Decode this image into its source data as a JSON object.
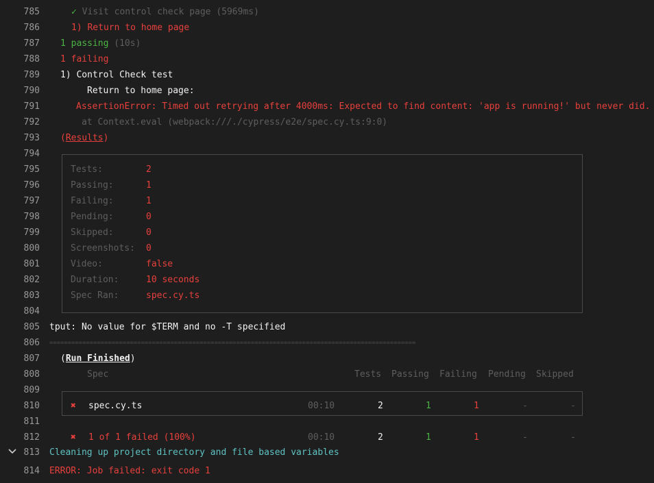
{
  "line_numbers": [
    "785",
    "786",
    "787",
    "788",
    "789",
    "790",
    "791",
    "792",
    "793",
    "794",
    "795",
    "796",
    "797",
    "798",
    "799",
    "800",
    "801",
    "802",
    "803",
    "804",
    "805",
    "806",
    "807",
    "808",
    "809",
    "810",
    "811",
    "812",
    "813",
    "814"
  ],
  "log": {
    "l785": {
      "check": "✓",
      "text": "Visit control check page (5969ms)"
    },
    "l786": "1) Return to home page",
    "l787": {
      "count": "1 passing",
      "time": "(10s)"
    },
    "l788": "1 failing",
    "l789": "1) Control Check test",
    "l790": "Return to home page:",
    "l791": "AssertionError: Timed out retrying after 4000ms: Expected to find content: 'app is running!' but never did.",
    "l792": "at Context.eval (webpack:///./cypress/e2e/spec.cy.ts:9:0)",
    "l793": "Results",
    "results": {
      "rows": [
        {
          "label": "Tests:",
          "value": "2"
        },
        {
          "label": "Passing:",
          "value": "1"
        },
        {
          "label": "Failing:",
          "value": "1"
        },
        {
          "label": "Pending:",
          "value": "0"
        },
        {
          "label": "Skipped:",
          "value": "0"
        },
        {
          "label": "Screenshots:",
          "value": "0"
        },
        {
          "label": "Video:",
          "value": "false"
        },
        {
          "label": "Duration:",
          "value": "10 seconds"
        },
        {
          "label": "Spec Ran:",
          "value": "spec.cy.ts"
        }
      ]
    },
    "l805": "tput: No value for $TERM and no -T specified",
    "l806": "====================================================================================================",
    "l807": "Run Finished",
    "run_table": {
      "headers": {
        "spec": "Spec",
        "tests": "Tests",
        "passing": "Passing",
        "failing": "Failing",
        "pending": "Pending",
        "skipped": "Skipped"
      },
      "row": {
        "mark": "✖",
        "spec": "spec.cy.ts",
        "time": "00:10",
        "tests": "2",
        "passing": "1",
        "failing": "1",
        "pending": "-",
        "skipped": "-"
      },
      "summary": {
        "mark": "✖",
        "spec": "1 of 1 failed (100%)",
        "time": "00:10",
        "tests": "2",
        "passing": "1",
        "failing": "1",
        "pending": "-",
        "skipped": "-"
      }
    },
    "l813": "Cleaning up project directory and file based variables",
    "l814": "ERROR: Job failed: exit code 1"
  },
  "colors": {
    "background": "#1e1e1e",
    "error": "#e8403c",
    "success": "#4bb543",
    "info": "#5fc3c3",
    "muted": "#5e5e5e"
  },
  "icons": {
    "section_toggle": "chevron-down-icon"
  }
}
